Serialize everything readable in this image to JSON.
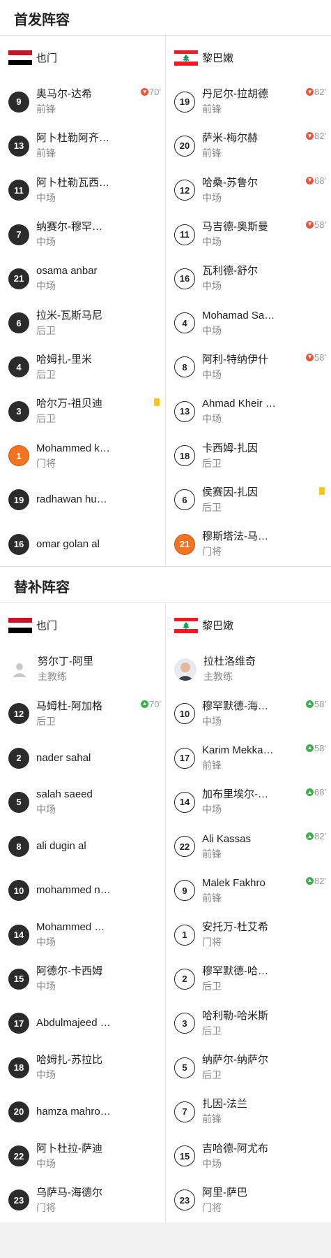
{
  "starting": {
    "title": "首发阵容",
    "home": {
      "name": "也门"
    },
    "away": {
      "name": "黎巴嫩"
    },
    "home_players": [
      {
        "num": "9",
        "name": "奥马尔-达希",
        "pos": "前锋",
        "sub": "70'",
        "sub_type": "out"
      },
      {
        "num": "13",
        "name": "阿卜杜勒阿齐…",
        "pos": "前锋"
      },
      {
        "num": "11",
        "name": "阿卜杜勒瓦西…",
        "pos": "中场"
      },
      {
        "num": "7",
        "name": "纳赛尔-穆罕…",
        "pos": "中场"
      },
      {
        "num": "21",
        "name": "osama anbar",
        "pos": "中场"
      },
      {
        "num": "6",
        "name": "拉米-瓦斯马尼",
        "pos": "后卫"
      },
      {
        "num": "4",
        "name": "哈姆扎-里米",
        "pos": "后卫"
      },
      {
        "num": "3",
        "name": "哈尔万-祖贝迪",
        "pos": "后卫",
        "card": "yellow"
      },
      {
        "num": "1",
        "name": "Mohammed k…",
        "pos": "门将",
        "gk": true
      },
      {
        "num": "19",
        "name": "radhawan hu…",
        "pos": ""
      },
      {
        "num": "16",
        "name": "omar golan al",
        "pos": ""
      }
    ],
    "away_players": [
      {
        "num": "19",
        "name": "丹尼尔-拉胡德",
        "pos": "前锋",
        "sub": "82'",
        "sub_type": "out"
      },
      {
        "num": "20",
        "name": "萨米-梅尔赫",
        "pos": "前锋",
        "sub": "82'",
        "sub_type": "out"
      },
      {
        "num": "12",
        "name": "哈桑-苏鲁尔",
        "pos": "中场",
        "sub": "68'",
        "sub_type": "out"
      },
      {
        "num": "11",
        "name": "马吉德-奥斯曼",
        "pos": "中场",
        "sub": "58'",
        "sub_type": "out"
      },
      {
        "num": "16",
        "name": "瓦利德-舒尔",
        "pos": "中场"
      },
      {
        "num": "4",
        "name": "Mohamad Sa…",
        "pos": "中场"
      },
      {
        "num": "8",
        "name": "阿利-特纳伊什",
        "pos": "中场",
        "sub": "58'",
        "sub_type": "out"
      },
      {
        "num": "13",
        "name": "Ahmad Kheir …",
        "pos": "中场"
      },
      {
        "num": "18",
        "name": "卡西姆-扎因",
        "pos": "后卫"
      },
      {
        "num": "6",
        "name": "侯赛因-扎因",
        "pos": "后卫",
        "card": "yellow"
      },
      {
        "num": "21",
        "name": "穆斯塔法-马…",
        "pos": "门将",
        "gk": true
      }
    ]
  },
  "subs": {
    "title": "替补阵容",
    "home": {
      "name": "也门"
    },
    "away": {
      "name": "黎巴嫩"
    },
    "home_coach": {
      "name": "努尔丁-阿里",
      "role": "主教练"
    },
    "away_coach": {
      "name": "拉杜洛维奇",
      "role": "主教练"
    },
    "home_players": [
      {
        "num": "12",
        "name": "马姆杜-阿加格",
        "pos": "后卫",
        "sub": "70'",
        "sub_type": "in"
      },
      {
        "num": "2",
        "name": "nader sahal",
        "pos": ""
      },
      {
        "num": "5",
        "name": "salah saeed",
        "pos": "中场"
      },
      {
        "num": "8",
        "name": "ali dugin al",
        "pos": ""
      },
      {
        "num": "10",
        "name": "mohammed n…",
        "pos": ""
      },
      {
        "num": "14",
        "name": "Mohammed …",
        "pos": "中场"
      },
      {
        "num": "15",
        "name": "阿德尔-卡西姆",
        "pos": "中场"
      },
      {
        "num": "17",
        "name": "Abdulmajeed …",
        "pos": ""
      },
      {
        "num": "18",
        "name": "哈姆扎-苏拉比",
        "pos": "中场"
      },
      {
        "num": "20",
        "name": "hamza mahro…",
        "pos": ""
      },
      {
        "num": "22",
        "name": "阿卜杜拉-萨迪",
        "pos": "中场"
      },
      {
        "num": "23",
        "name": "乌萨马-海德尔",
        "pos": "门将"
      }
    ],
    "away_players": [
      {
        "num": "10",
        "name": "穆罕默德-海…",
        "pos": "中场",
        "sub": "58'",
        "sub_type": "in"
      },
      {
        "num": "17",
        "name": "Karim Mekka…",
        "pos": "前锋",
        "sub": "58'",
        "sub_type": "in"
      },
      {
        "num": "14",
        "name": "加布里埃尔-…",
        "pos": "中场",
        "sub": "68'",
        "sub_type": "in"
      },
      {
        "num": "22",
        "name": "Ali Kassas",
        "pos": "前锋",
        "sub": "82'",
        "sub_type": "in"
      },
      {
        "num": "9",
        "name": "Malek Fakhro",
        "pos": "前锋",
        "sub": "82'",
        "sub_type": "in"
      },
      {
        "num": "1",
        "name": "安托万-杜艾希",
        "pos": "门将"
      },
      {
        "num": "2",
        "name": "穆罕默德-哈…",
        "pos": "后卫"
      },
      {
        "num": "3",
        "name": "哈利勒-哈米斯",
        "pos": "后卫"
      },
      {
        "num": "5",
        "name": "纳萨尔-纳萨尔",
        "pos": "后卫"
      },
      {
        "num": "7",
        "name": "扎因-法兰",
        "pos": "前锋"
      },
      {
        "num": "15",
        "name": "吉哈德-阿尤布",
        "pos": "中场"
      },
      {
        "num": "23",
        "name": "阿里-萨巴",
        "pos": "门将"
      }
    ]
  },
  "colors": {
    "yemen_flag": [
      "#ce1126",
      "#ffffff",
      "#000000"
    ],
    "lebanon_flag": [
      "#ed1c24",
      "#ffffff",
      "#00a651"
    ],
    "gk_badge": "#f47321",
    "sub_out": "#e8553b",
    "sub_in": "#3cb14a",
    "yellow_card": "#f6c718"
  },
  "icons": {
    "sub_out": "arrow-down-icon",
    "sub_in": "arrow-up-icon",
    "placeholder": "person-placeholder-icon"
  }
}
